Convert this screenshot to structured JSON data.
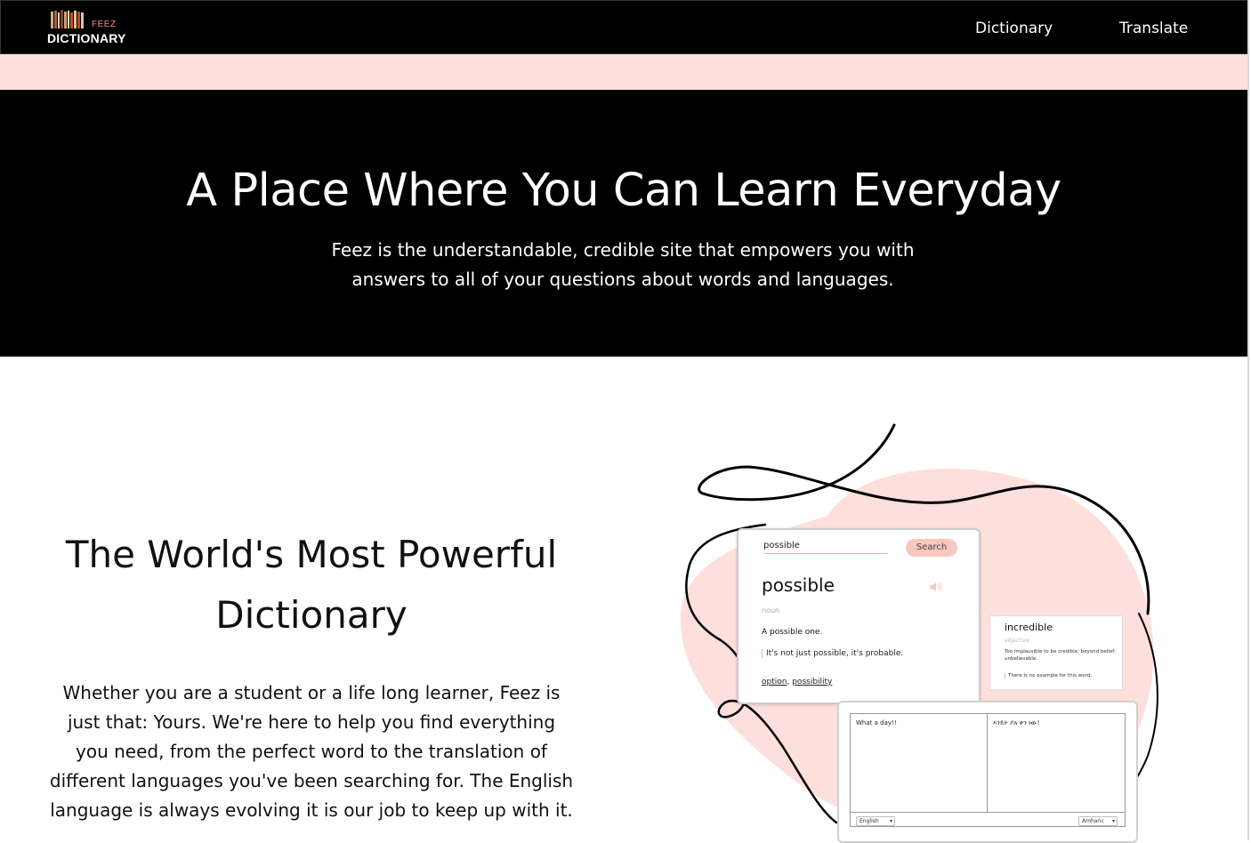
{
  "nav": {
    "logo": {
      "small": "FEEZ",
      "main": "DICTIONARY"
    },
    "links": [
      "Dictionary",
      "Translate"
    ]
  },
  "hero": {
    "title": "A Place Where You Can Learn Everyday",
    "subtitle_line1": "Feez is the understandable, credible site that empowers you with",
    "subtitle_line2": "answers to all of your questions about words and languages."
  },
  "feature": {
    "title_line1": "The World's Most Powerful",
    "title_line2": "Dictionary",
    "text_lines": [
      "Whether you are a student or a life long learner, Feez is",
      "just that: Yours. We're here to help you find everything",
      "you need, from the perfect word to the translation of",
      "different languages you've been searching for. The English",
      "language is always evolving it is our job to keep up with it."
    ]
  },
  "illustration": {
    "dictionary_card": {
      "search_value": "possible",
      "search_button": "Search",
      "word": "possible",
      "part_of_speech": "noun",
      "definition": "A possible one.",
      "example": "It's not just possible, it's probable.",
      "synonyms": [
        "option",
        "possibility"
      ],
      "synonym_separator": ","
    },
    "side_card": {
      "word": "incredible",
      "part_of_speech": "adjective",
      "definition": "Too implausible to be credible; beyond belief; unbelievable.",
      "example": "There is no example for this word."
    },
    "translate_card": {
      "source_text": "What a day!!",
      "target_text": "እንዴት ያለ ቀን ነው!",
      "source_lang": "English",
      "target_lang": "Amharic"
    }
  },
  "colors": {
    "black": "#000000",
    "pink_light": "#fddfdc",
    "pink_accent": "#f7c7c0",
    "logo_accent": "#f08c7a"
  }
}
